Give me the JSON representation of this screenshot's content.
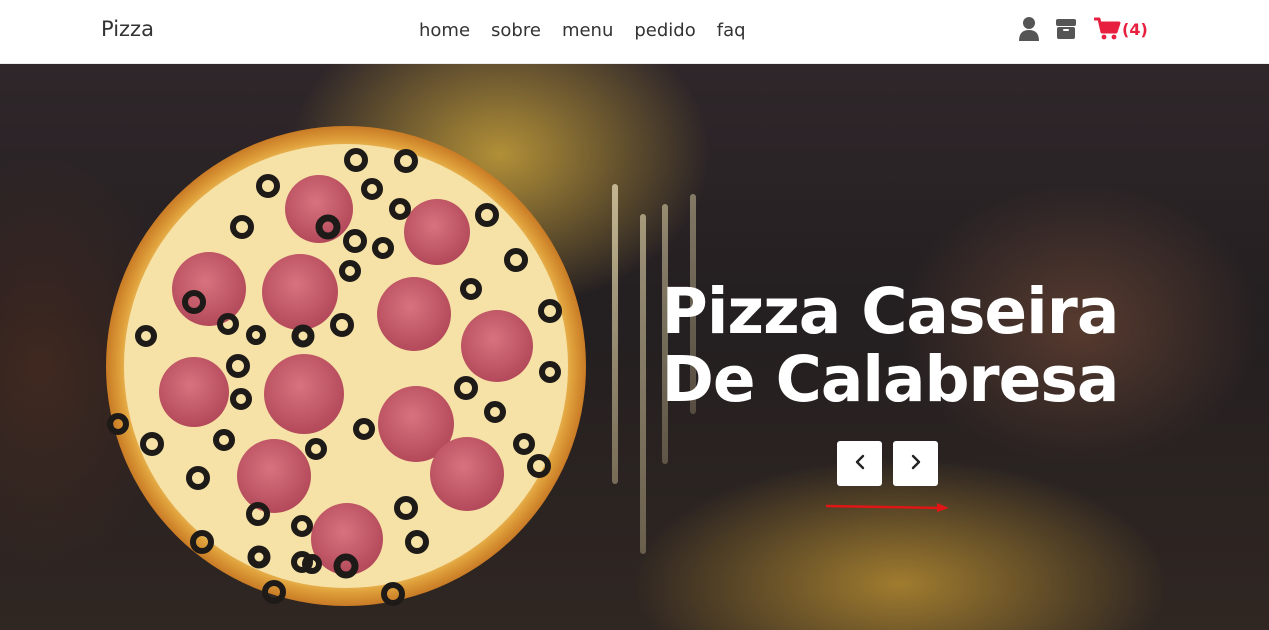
{
  "header": {
    "brand": "Pizza",
    "nav": [
      "home",
      "sobre",
      "menu",
      "pedido",
      "faq"
    ],
    "cart_count": "(4)"
  },
  "icons": {
    "user": "user-icon",
    "orders": "box-icon",
    "cart": "shopping-cart-icon",
    "prev": "chevron-left-icon",
    "next": "chevron-right-icon"
  },
  "hero": {
    "title_line1": "Pizza Caseira",
    "title_line2": "De Calabresa"
  },
  "colors": {
    "accent": "#e8203f",
    "text": "#333333",
    "icon_gray": "#555555"
  }
}
